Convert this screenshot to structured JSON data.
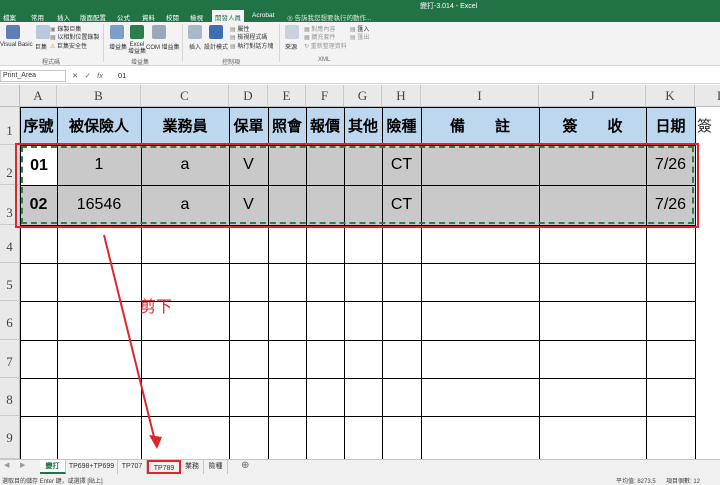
{
  "window": {
    "title": "變打-3.014 - Excel"
  },
  "ribbon": {
    "tabs": [
      "檔案",
      "常用",
      "插入",
      "版面配置",
      "公式",
      "資料",
      "校閱",
      "檢視",
      "開發人員",
      "Acrobat"
    ],
    "active_tab": "開發人員",
    "tell_me": "告訴我您想要執行的動作...",
    "buttons": {
      "visual_basic": "Visual Basic",
      "macros": "巨集",
      "record_macro": "錄製巨集",
      "relative_refs": "以相對位置錄製",
      "macro_security": "巨集安全性",
      "addins": "增益集",
      "excel_addins": "Excel 增益集",
      "com_addins": "COM 增益集",
      "insert": "插入",
      "design_mode": "設計模式",
      "properties": "屬性",
      "view_code": "檢視程式碼",
      "run_dialog": "執行對話方塊",
      "source": "來源",
      "map_properties": "對應內容",
      "expansion_packs": "擴充套件",
      "refresh_data": "重新整理資料",
      "import": "匯入",
      "export": "匯出"
    },
    "groups": [
      "程式碼",
      "增益集",
      "控制項",
      "XML"
    ]
  },
  "formula_bar": {
    "name_box": "Print_Area",
    "cancel": "✕",
    "enter": "✓",
    "fx": "fx",
    "value": "01"
  },
  "columns": [
    "A",
    "B",
    "C",
    "D",
    "E",
    "F",
    "G",
    "H",
    "I",
    "J",
    "K",
    "L"
  ],
  "rows": [
    "1",
    "2",
    "3",
    "4",
    "5",
    "6",
    "7",
    "8",
    "9"
  ],
  "table": {
    "headers": [
      "序號",
      "被保險人",
      "業務員",
      "保單",
      "照會",
      "報價",
      "其他",
      "險種",
      "備　　註",
      "簽　　收",
      "日期"
    ],
    "overflow_header": "簽",
    "data": [
      [
        "01",
        "1",
        "a",
        "V",
        "",
        "",
        "",
        "CT",
        "",
        "",
        "7/26"
      ],
      [
        "02",
        "16546",
        "a",
        "V",
        "",
        "",
        "",
        "CT",
        "",
        "",
        "7/26"
      ]
    ]
  },
  "annotation": {
    "text": "剪下",
    "color": "#e0262b"
  },
  "colors": {
    "header_fill": "#bdd7ee",
    "data_fill": "#c9c9c9",
    "highlight_red": "#e0262b",
    "excel_green": "#217346"
  },
  "sheet_tabs": [
    "變打",
    "TP698+TP699",
    "TP707",
    "TP789",
    "業務",
    "險種"
  ],
  "active_sheet": "變打",
  "highlighted_sheet": "TP789",
  "add_sheet": "⊕",
  "status": {
    "left": "選取目的儲存 Enter 鍵，或選擇 [貼上]",
    "average": "平均值: 8273.5",
    "count": "項目個數: 12"
  }
}
